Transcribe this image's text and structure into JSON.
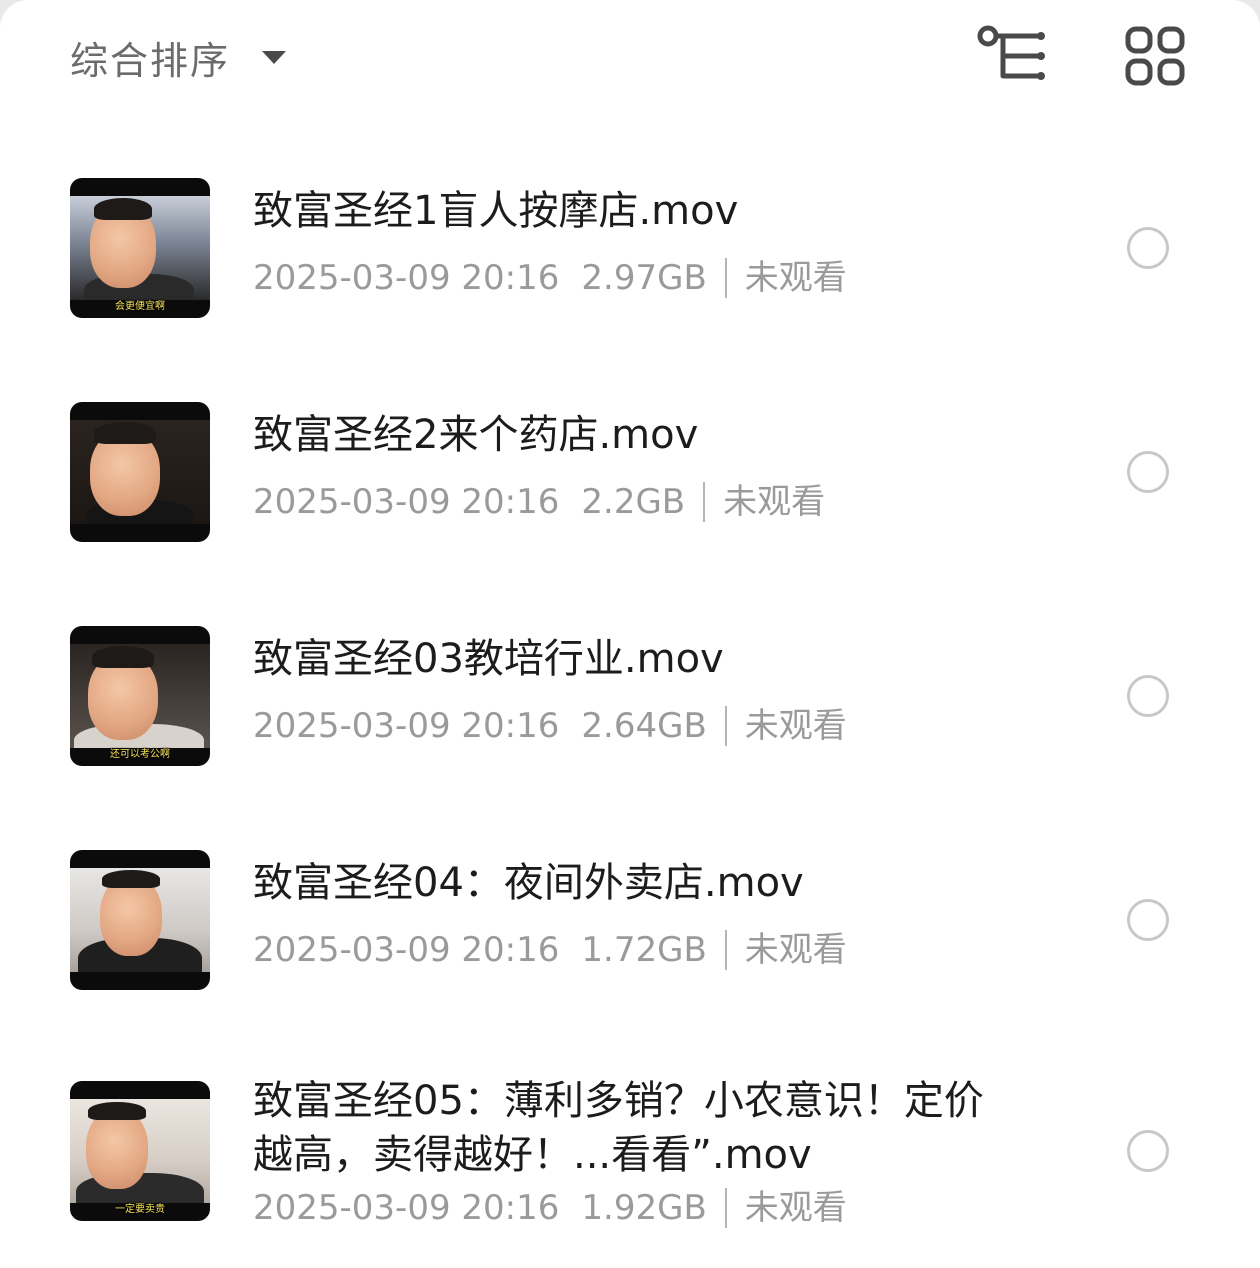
{
  "toolbar": {
    "sort_label": "综合排序",
    "sort_icon": "caret-down-icon",
    "tree_view_icon": "tree-structure-icon",
    "grid_view_icon": "grid-view-icon"
  },
  "files": [
    {
      "name": "致富圣经1盲人按摩店.mov",
      "date": "2025-03-09 20:16",
      "size": "2.97GB",
      "status": "未观看",
      "thumb_caption": "会更便宜啊"
    },
    {
      "name": "致富圣经2来个药店.mov",
      "date": "2025-03-09 20:16",
      "size": "2.2GB",
      "status": "未观看",
      "thumb_caption": ""
    },
    {
      "name": "致富圣经03教培行业.mov",
      "date": "2025-03-09 20:16",
      "size": "2.64GB",
      "status": "未观看",
      "thumb_caption": "还可以考公啊"
    },
    {
      "name": "致富圣经04：夜间外卖店.mov",
      "date": "2025-03-09 20:16",
      "size": "1.72GB",
      "status": "未观看",
      "thumb_caption": ""
    },
    {
      "name": "致富圣经05：薄利多销？小农意识！定价越高，卖得越好！...看看”.mov",
      "date": "2025-03-09 20:16",
      "size": "1.92GB",
      "status": "未观看",
      "thumb_caption": "一定要卖贵"
    }
  ],
  "colors": {
    "title": "#1c1c1c",
    "meta": "#9a9a9a",
    "radio_border": "#c8c8c8",
    "icon": "#4a4a4a"
  }
}
